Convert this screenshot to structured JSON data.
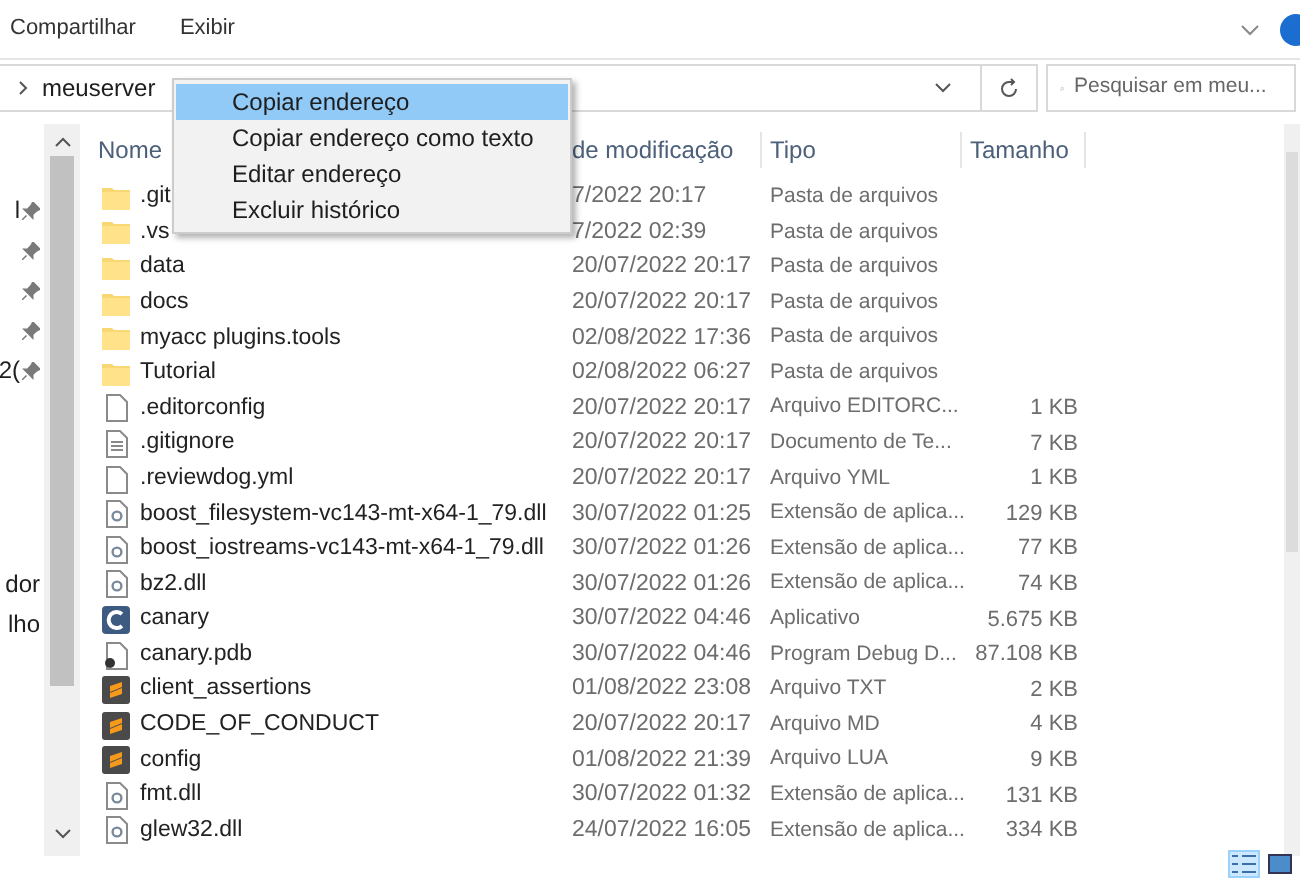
{
  "ribbon": {
    "tabs": [
      {
        "label": "Compartilhar"
      },
      {
        "label": "Exibir"
      }
    ]
  },
  "address_bar": {
    "path": "meuserver"
  },
  "search": {
    "placeholder": "Pesquisar em meu..."
  },
  "nav_pane": [
    {
      "text": "l",
      "pinned": true
    },
    {
      "pinned": true
    },
    {
      "pinned": true
    },
    {
      "pinned": true
    },
    {
      "text": "2(",
      "pinned": true
    },
    {
      "text": "dor",
      "pinned": false
    },
    {
      "text": "lho",
      "pinned": false
    }
  ],
  "table": {
    "columns": [
      "Nome",
      "de modificação",
      "Tipo",
      "Tamanho"
    ],
    "rows": [
      {
        "kind": "folder",
        "name": ".git",
        "date": "7/2022 20:17",
        "type": "Pasta de arquivos"
      },
      {
        "kind": "folder",
        "name": ".vs",
        "date": "7/2022 02:39",
        "type": "Pasta de arquivos"
      },
      {
        "kind": "folder",
        "name": "data",
        "date": "20/07/2022 20:17",
        "type": "Pasta de arquivos"
      },
      {
        "kind": "folder",
        "name": "docs",
        "date": "20/07/2022 20:17",
        "type": "Pasta de arquivos"
      },
      {
        "kind": "folder",
        "name": "myacc plugins.tools",
        "date": "02/08/2022 17:36",
        "type": "Pasta de arquivos"
      },
      {
        "kind": "folder",
        "name": "Tutorial",
        "date": "02/08/2022 06:27",
        "type": "Pasta de arquivos"
      },
      {
        "kind": "file",
        "name": ".editorconfig",
        "date": "20/07/2022 20:17",
        "type": "Arquivo EDITORC...",
        "size": "1 KB"
      },
      {
        "kind": "text",
        "name": ".gitignore",
        "date": "20/07/2022 20:17",
        "type": "Documento de Te...",
        "size": "7 KB"
      },
      {
        "kind": "file",
        "name": ".reviewdog.yml",
        "date": "20/07/2022 20:17",
        "type": "Arquivo YML",
        "size": "1 KB"
      },
      {
        "kind": "dll",
        "name": "boost_filesystem-vc143-mt-x64-1_79.dll",
        "date": "30/07/2022 01:25",
        "type": "Extensão de aplica...",
        "size": "129 KB"
      },
      {
        "kind": "dll",
        "name": "boost_iostreams-vc143-mt-x64-1_79.dll",
        "date": "30/07/2022 01:26",
        "type": "Extensão de aplica...",
        "size": "77 KB"
      },
      {
        "kind": "dll",
        "name": "bz2.dll",
        "date": "30/07/2022 01:26",
        "type": "Extensão de aplica...",
        "size": "74 KB"
      },
      {
        "kind": "app",
        "name": "canary",
        "date": "30/07/2022 04:46",
        "type": "Aplicativo",
        "size": "5.675 KB"
      },
      {
        "kind": "pdb",
        "name": "canary.pdb",
        "date": "30/07/2022 04:46",
        "type": "Program Debug D...",
        "size": "87.108 KB"
      },
      {
        "kind": "editor",
        "name": "client_assertions",
        "date": "01/08/2022 23:08",
        "type": "Arquivo TXT",
        "size": "2 KB"
      },
      {
        "kind": "editor",
        "name": "CODE_OF_CONDUCT",
        "date": "20/07/2022 20:17",
        "type": "Arquivo MD",
        "size": "4 KB"
      },
      {
        "kind": "editor",
        "name": "config",
        "date": "01/08/2022 21:39",
        "type": "Arquivo LUA",
        "size": "9 KB"
      },
      {
        "kind": "dll",
        "name": "fmt.dll",
        "date": "30/07/2022 01:32",
        "type": "Extensão de aplica...",
        "size": "131 KB"
      },
      {
        "kind": "dll",
        "name": "glew32.dll",
        "date": "24/07/2022 16:05",
        "type": "Extensão de aplica...",
        "size": "334 KB"
      }
    ]
  },
  "context_menu": {
    "items": [
      {
        "label": "Copiar endereço",
        "selected": true
      },
      {
        "label": "Copiar endereço como texto",
        "selected": false
      },
      {
        "label": "Editar endereço",
        "selected": false
      },
      {
        "label": "Excluir histórico",
        "selected": false
      }
    ]
  },
  "view_buttons": [
    {
      "kind": "details",
      "selected": true
    },
    {
      "kind": "thumbnails",
      "selected": false
    }
  ]
}
